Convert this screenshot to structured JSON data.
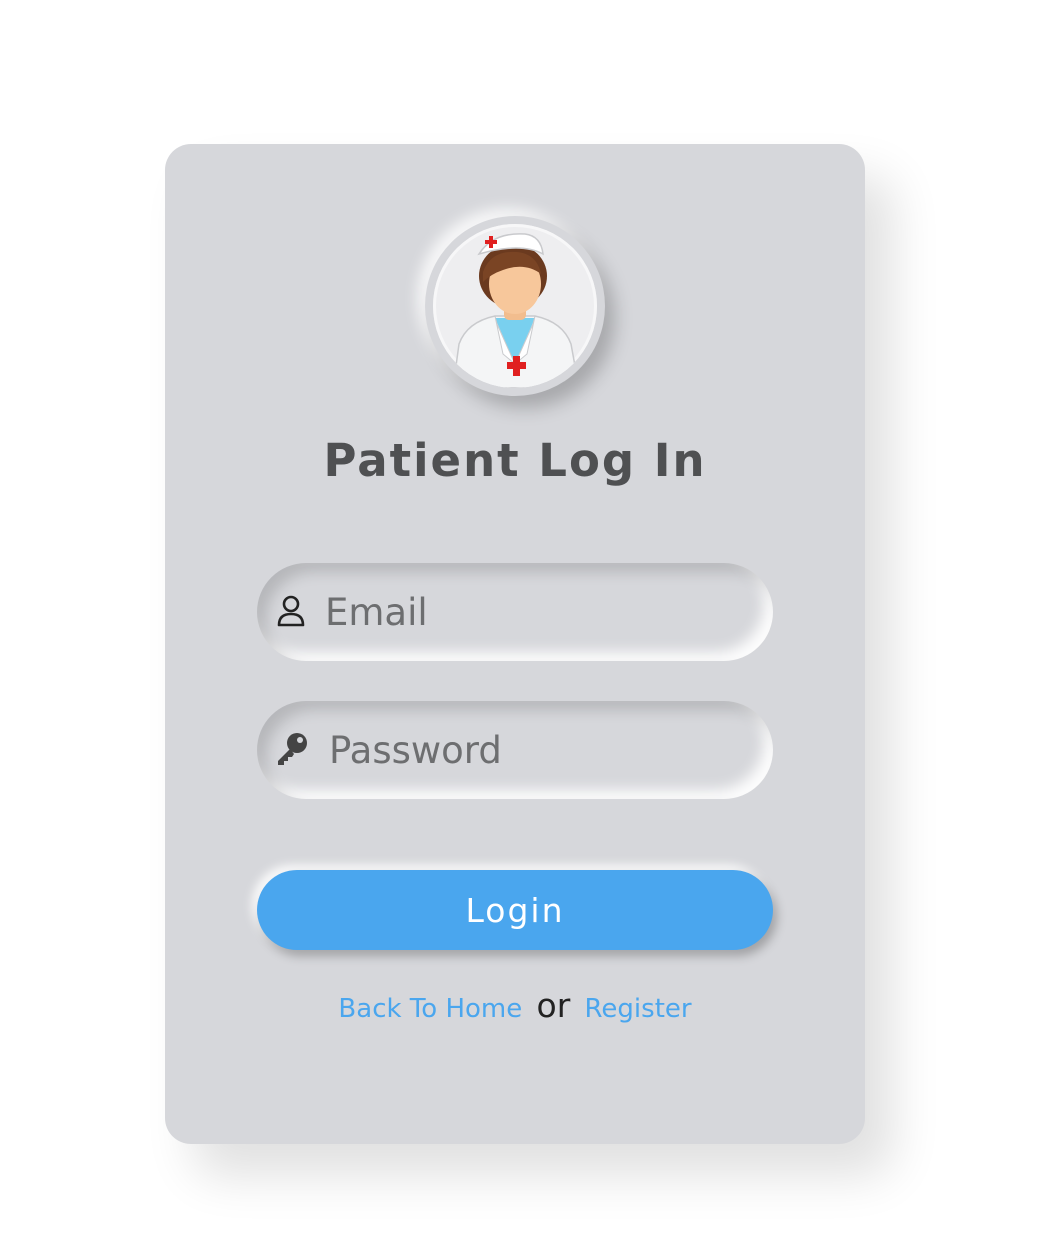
{
  "login_form": {
    "title": "Patient Log In",
    "email_placeholder": "Email",
    "password_placeholder": "Password",
    "login_label": "Login",
    "back_home_label": "Back To Home",
    "or_label": "or",
    "register_label": "Register"
  },
  "colors": {
    "card_bg": "#d6d7db",
    "accent": "#4aa6ee",
    "title_text": "#4f5052"
  },
  "icons": {
    "avatar": "doctor-avatar-icon",
    "email": "user-icon",
    "password": "key-icon"
  }
}
